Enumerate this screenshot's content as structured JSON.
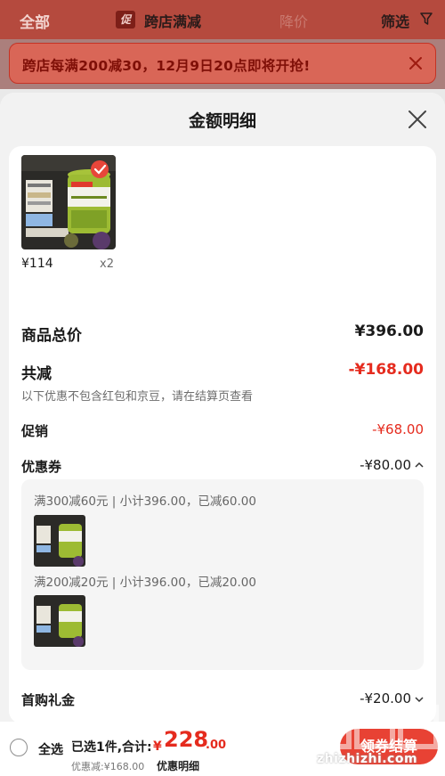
{
  "topnav": {
    "tab_all": "全部",
    "promo_badge": "促",
    "tab_cross_store": "跨店满减",
    "tab_price": "降价",
    "filter_label": "筛选"
  },
  "notice": {
    "text": "跨店每满200减30，12月9日20点即将开抢!"
  },
  "sheet": {
    "title": "金额明细"
  },
  "product": {
    "price": "¥114",
    "qty": "x2"
  },
  "detail": {
    "total_label": "商品总价",
    "total_value": "¥396.00",
    "reduce_label": "共减",
    "reduce_value": "-¥168.00",
    "reduce_note": "以下优惠不包含红包和京豆，请在结算页查看",
    "promo_label": "促销",
    "promo_value": "-¥68.00",
    "coupon_label": "优惠券",
    "coupon_value": "-¥80.00",
    "coupons": [
      {
        "text": "满300减60元 | 小计396.00，已减60.00"
      },
      {
        "text": "满200减20元 | 小计396.00，已减20.00"
      }
    ],
    "gift_label": "首购礼金",
    "gift_value": "-¥20.00"
  },
  "bottom": {
    "select_all": "全选",
    "selected_count": "已选1件,合计:",
    "total_symbol": "¥",
    "total_int": "228",
    "total_dec": ".00",
    "saved": "优惠减:¥168.00",
    "detail_link": "优惠明细",
    "checkout": "领券结算"
  },
  "watermark": {
    "domain": "zhizhizhi.com"
  },
  "colors": {
    "accent_red": "#e52b1e",
    "checkout_red": "#e84234"
  }
}
